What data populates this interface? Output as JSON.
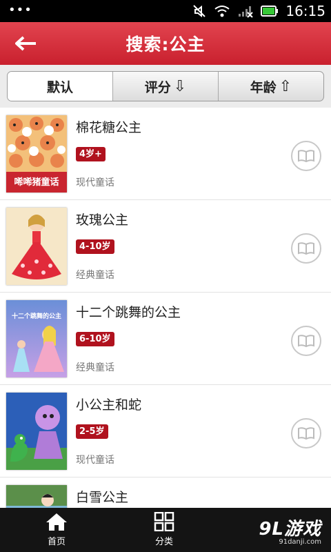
{
  "status_bar": {
    "time": "16:15"
  },
  "header": {
    "title": "搜索:公主"
  },
  "sort_tabs": [
    {
      "label": "默认",
      "arrow": ""
    },
    {
      "label": "评分",
      "arrow": "⇩"
    },
    {
      "label": "年龄",
      "arrow": "⇧"
    }
  ],
  "books": [
    {
      "title": "棉花糖公主",
      "age": "4岁+",
      "category": "现代童话",
      "cover_text": "唏唏猪童话"
    },
    {
      "title": "玫瑰公主",
      "age": "4-10岁",
      "category": "经典童话"
    },
    {
      "title": "十二个跳舞的公主",
      "age": "6-10岁",
      "category": "经典童话",
      "cover_text": "十二个跳舞的公主"
    },
    {
      "title": "小公主和蛇",
      "age": "2-5岁",
      "category": "现代童话"
    },
    {
      "title": "白雪公主",
      "age": "",
      "category": ""
    }
  ],
  "bottom_nav": [
    {
      "label": "首页",
      "icon": "home-icon"
    },
    {
      "label": "分类",
      "icon": "grid-icon"
    }
  ],
  "watermark": {
    "brand": "9L游戏",
    "url": "91danji.com"
  },
  "colors": {
    "header_red": "#d32f3b",
    "badge_red": "#b0121e",
    "nav_bg": "#141414"
  }
}
